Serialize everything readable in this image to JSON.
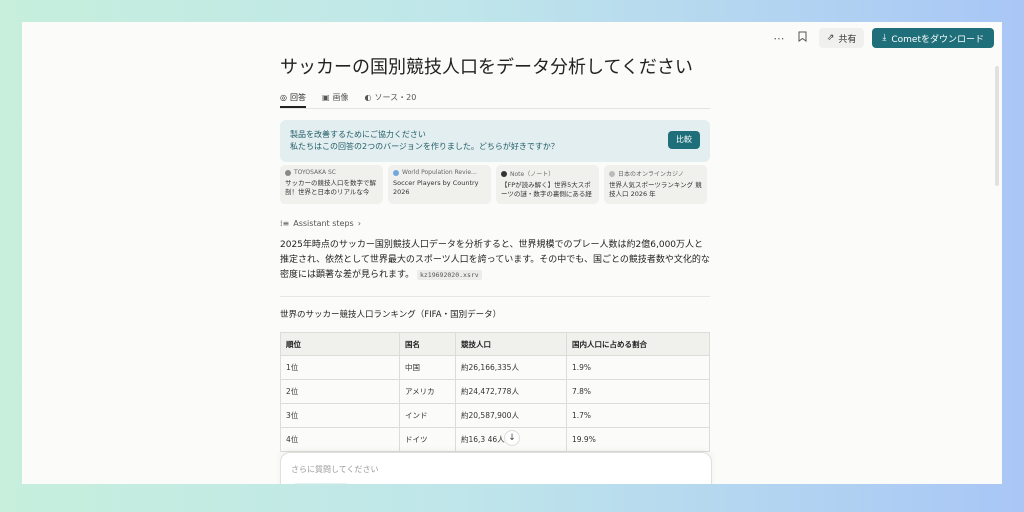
{
  "topbar": {
    "more_icon": "⋯",
    "bookmark_icon": "bookmark-icon",
    "share_label": "共有",
    "comet_label": "Cometをダウンロード"
  },
  "title": "サッカーの国別競技人口をデータ分析してください",
  "tabs": [
    {
      "label": "回答",
      "icon": "answer-icon"
    },
    {
      "label": "画像",
      "icon": "image-icon"
    },
    {
      "label": "ソース・20",
      "icon": "sources-icon"
    }
  ],
  "feedback": {
    "line1": "製品を改善するためにご協力ください",
    "line2": "私たちはこの回答の2つのバージョンを作りました。どちらが好きですか？",
    "button": "比較"
  },
  "sources": [
    {
      "site": "TOYOSAKA SC",
      "title": "サッカーの競技人口を数字で解剖！世界と日本のリアルな今"
    },
    {
      "site": "World Population Revie...",
      "title": "Soccer Players by Country 2026"
    },
    {
      "site": "Note（ノート）",
      "title": "【FPが読み解く】世界5大スポーツの謎・数字の裏側にある経済..."
    },
    {
      "site": "日本のオンラインカジノ",
      "title": "世界人気スポーツランキング 競技人口 2026 年"
    }
  ],
  "assistant_steps": "Assistant steps",
  "paragraph": "2025年時点のサッカー国別競技人口データを分析すると、世界規模でのプレー人数は約2億6,000万人と推定され、依然として世界最大のスポーツ人口を誇っています。その中でも、国ごとの競技者数や文化的な密度には顕著な差が見られます。",
  "code_chip": "kz19692020.xsrv",
  "section_title": "世界のサッカー競技人口ランキング（FIFA・国別データ）",
  "table": {
    "headers": [
      "順位",
      "国名",
      "競技人口",
      "国内人口に占める割合"
    ],
    "rows": [
      [
        "1位",
        "中国",
        "約26,166,335人",
        "1.9%"
      ],
      [
        "2位",
        "アメリカ",
        "約24,472,778人",
        "7.8%"
      ],
      [
        "3位",
        "インド",
        "約20,587,900人",
        "1.7%"
      ],
      [
        "4位",
        "ドイツ",
        "約16,3 46人",
        "19.9%"
      ]
    ]
  },
  "ask_placeholder": "さらに質問してください"
}
